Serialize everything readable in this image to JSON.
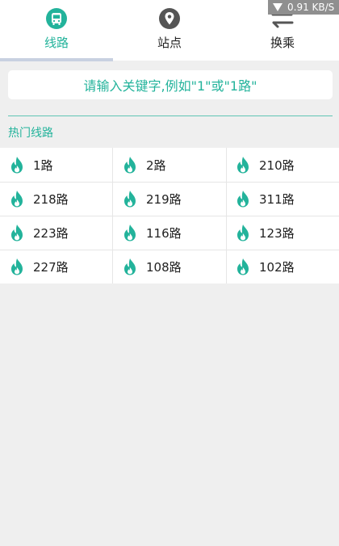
{
  "status": {
    "speed": "0.91 KB/S"
  },
  "tabs": [
    {
      "label": "线路",
      "icon": "bus-icon",
      "active": true
    },
    {
      "label": "站点",
      "icon": "location-pin-icon",
      "active": false
    },
    {
      "label": "换乘",
      "icon": "swap-arrows-icon",
      "active": false
    }
  ],
  "search": {
    "placeholder": "请输入关键字,例如\"1\"或\"1路\""
  },
  "hot": {
    "title": "热门线路",
    "icon": "flame-icon",
    "routes": [
      "1路",
      "2路",
      "210路",
      "218路",
      "219路",
      "311路",
      "223路",
      "116路",
      "123路",
      "227路",
      "108路",
      "102路"
    ]
  },
  "colors": {
    "accent": "#23b39b",
    "icon_gray": "#555555",
    "indicator": "#c8d1e1"
  }
}
